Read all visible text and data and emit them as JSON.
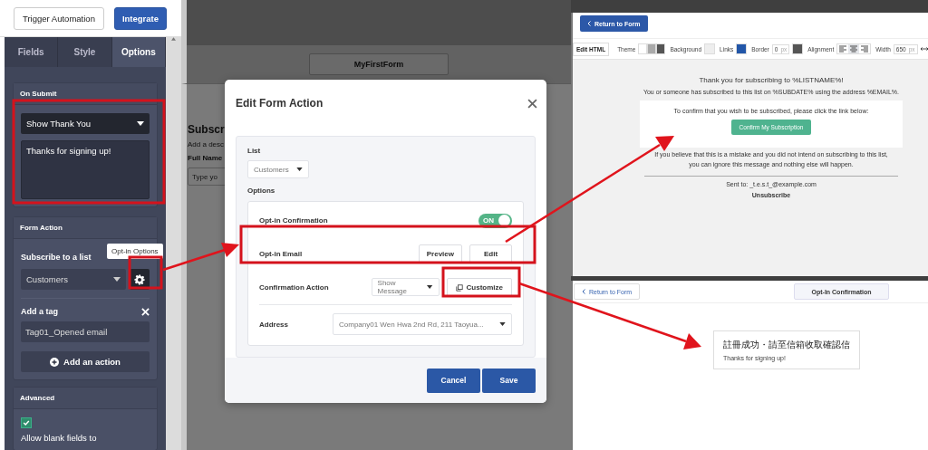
{
  "sidebar": {
    "header_buttons": [
      {
        "label": "Trigger Automation",
        "kind": "outline"
      },
      {
        "label": "Integrate",
        "kind": "primary"
      }
    ],
    "tabs": [
      {
        "label": "Fields",
        "selected": false
      },
      {
        "label": "Style",
        "selected": false
      },
      {
        "label": "Options",
        "selected": true
      }
    ],
    "on_submit": {
      "title": "On Submit",
      "action": "Show Thank You",
      "message": "Thanks for signing up!"
    },
    "form_action": {
      "title": "Form Action",
      "subscribe_label": "Subscribe to a list",
      "list": "Customers",
      "tooltip": "Opt-in Options",
      "tag_label": "Add a tag",
      "tag": "Tag01_Opened email",
      "add_action": "Add an action"
    },
    "advanced": {
      "title": "Advanced",
      "option": {
        "label": "Allow blank fields to",
        "checked": true
      }
    }
  },
  "form_editor": {
    "form_name": "MyFirstForm",
    "title": "Subscr",
    "description": "Add a desc",
    "field_label": "Full Name",
    "field_placeholder": "Type yo"
  },
  "modal": {
    "title": "Edit Form Action",
    "list_label": "List",
    "list": "Customers",
    "options_label": "Options",
    "options": [
      {
        "kind": "toggle",
        "label": "Opt-in Confirmation",
        "on": true,
        "state_label": "ON"
      },
      {
        "kind": "buttons",
        "label": "Opt-in Email",
        "buttons": [
          "Preview",
          "Edit"
        ]
      },
      {
        "kind": "select_button",
        "label": "Confirmation Action",
        "value": "Show Message",
        "button": "Customize"
      },
      {
        "kind": "select",
        "label": "Address",
        "value": "Company01 Wen Hwa 2nd Rd, 211 Taoyua..."
      }
    ],
    "buttons": [
      "Cancel",
      "Save"
    ]
  },
  "email_editor": {
    "back_button": "Return to Form",
    "edit_html_tab": "Edit HTML",
    "toolbar": {
      "theme": "Theme",
      "background": "Background",
      "links": "Links",
      "border": "Border",
      "border_value": "0",
      "border_unit": "px",
      "alignment": "Alignment",
      "width": "Width",
      "width_value": "650",
      "width_unit": "px"
    },
    "alignment_options": [
      {
        "selected": false
      },
      {
        "selected": true
      },
      {
        "selected": false
      }
    ],
    "email": {
      "heading": "Thank you for subscribing to %LISTNAME%!",
      "subscribed_note": "You or someone has subscribed to this list on %SUBDATE% using the address %EMAIL%.",
      "confirm_prompt": "To confirm that you wish to be subscribed, please click the link below:",
      "confirm_button": "Confirm My Subscription",
      "mistake_note": [
        "If you believe that this is a mistake and you did not intend on subscribing to this list,",
        "you can ignore this message and nothing else will happen."
      ],
      "sent_to": "Sent to: _t.e.s.t_@example.com",
      "unsubscribe": "Unsubscribe"
    }
  },
  "confirmation_page": {
    "back_link": "Return to Form",
    "tab": "Opt-In Confirmation",
    "heading": "註冊成功・請至信箱收取確認信",
    "message": "Thanks for signing up!"
  }
}
